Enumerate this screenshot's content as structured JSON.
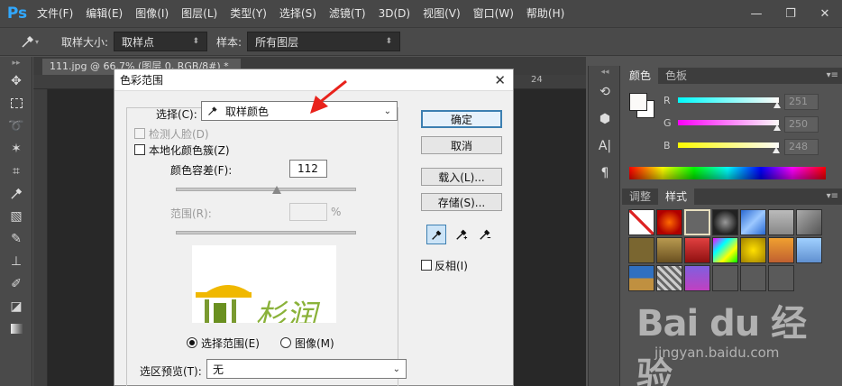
{
  "menubar": {
    "logo": "Ps",
    "items": [
      "文件(F)",
      "编辑(E)",
      "图像(I)",
      "图层(L)",
      "类型(Y)",
      "选择(S)",
      "滤镜(T)",
      "3D(D)",
      "视图(V)",
      "窗口(W)",
      "帮助(H)"
    ],
    "controls": [
      "—",
      "❐",
      "✕"
    ]
  },
  "options": {
    "sample_size_label": "取样大小:",
    "sample_size_value": "取样点",
    "sample_label": "样本:",
    "sample_value": "所有图层"
  },
  "document": {
    "tab_title": "111.jpg @ 66.7% (图层 0, RGB/8#) *",
    "ruler_mark": "24"
  },
  "dialog": {
    "title": "色彩范围",
    "select_label": "选择(C):",
    "select_value": "取样颜色",
    "detect_faces_label": "检测人脸(D)",
    "localized_label": "本地化颜色簇(Z)",
    "fuzziness_label": "颜色容差(F):",
    "fuzziness_value": "112",
    "fuzziness_level": 0.56,
    "range_label": "范围(R):",
    "range_unit": "%",
    "radio_selection": "选择范围(E)",
    "radio_image": "图像(M)",
    "preview_label": "选区预览(T):",
    "preview_value": "无",
    "btn_ok": "确定",
    "btn_cancel": "取消",
    "btn_load": "载入(L)...",
    "btn_save": "存储(S)...",
    "invert_label": "反相(I)",
    "close": "✕",
    "preview_text": "杉润"
  },
  "color_panel": {
    "tabs": [
      "颜色",
      "色板"
    ],
    "channels": [
      {
        "label": "R",
        "value": "251",
        "level": 0.984
      },
      {
        "label": "G",
        "value": "250",
        "level": 0.98
      },
      {
        "label": "B",
        "value": "248",
        "level": 0.973
      }
    ]
  },
  "styles_panel": {
    "tabs": [
      "调整",
      "样式"
    ]
  },
  "watermark": {
    "logo": "Bai du 经验",
    "url": "jingyan.baidu.com"
  }
}
